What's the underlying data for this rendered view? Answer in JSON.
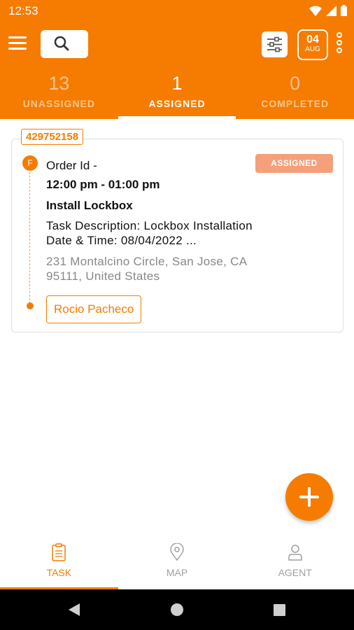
{
  "status_bar": {
    "time": "12:53"
  },
  "app_bar": {
    "date_day": "04",
    "date_month": "AUG"
  },
  "tabs": [
    {
      "count": "13",
      "label": "UNASSIGNED"
    },
    {
      "count": "1",
      "label": "ASSIGNED"
    },
    {
      "count": "0",
      "label": "COMPLETED"
    }
  ],
  "task_card": {
    "order_number": "429752158",
    "marker_letter": "F",
    "status": "ASSIGNED",
    "order_id_label": "Order Id -",
    "time_range": "12:00 pm - 01:00 pm",
    "title": "Install Lockbox",
    "description": "Task Description: Lockbox Installation",
    "datetime": "Date & Time: 08/04/2022 ...",
    "address_line1": "231 Montalcino Circle, San Jose, CA",
    "address_line2": "95111, United States",
    "agent_name": "Rocio Pacheco"
  },
  "bottom_nav": [
    {
      "label": "TASK",
      "icon": "clipboard-icon"
    },
    {
      "label": "MAP",
      "icon": "map-pin-icon"
    },
    {
      "label": "AGENT",
      "icon": "person-icon"
    }
  ],
  "colors": {
    "accent": "#f57c00",
    "status_badge": "#f5a07a"
  }
}
